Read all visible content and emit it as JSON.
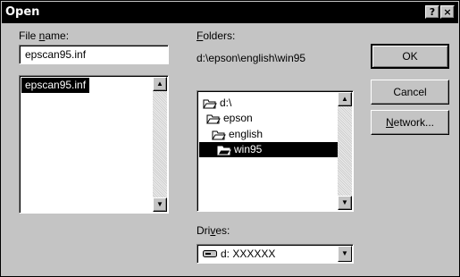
{
  "window": {
    "title": "Open",
    "help_glyph": "?",
    "close_glyph": "×"
  },
  "file_name": {
    "label_prefix": "File ",
    "label_mnemonic": "n",
    "label_suffix": "ame:",
    "value": "epscan95.inf",
    "list_items": [
      {
        "label": "epscan95.inf",
        "selected": true
      }
    ]
  },
  "folders": {
    "label_mnemonic": "F",
    "label_suffix": "olders:",
    "current_path": "d:\\epson\\english\\win95",
    "tree": [
      {
        "label": "d:\\",
        "icon": "open-folder-icon",
        "selected": false
      },
      {
        "label": "epson",
        "icon": "open-folder-icon",
        "selected": false
      },
      {
        "label": "english",
        "icon": "open-folder-icon",
        "selected": false
      },
      {
        "label": "win95",
        "icon": "open-folder-icon",
        "selected": true
      }
    ]
  },
  "drives": {
    "label_prefix": "Dri",
    "label_mnemonic": "v",
    "label_suffix": "es:",
    "value": "d: XXXXXX",
    "icon": "drive-icon"
  },
  "buttons": {
    "ok": "OK",
    "cancel": "Cancel",
    "network_mnemonic": "N",
    "network_suffix": "etwork..."
  },
  "icons": {
    "scroll_up": "▲",
    "scroll_down": "▼",
    "dropdown": "▼"
  },
  "colors": {
    "face": "#c4c4c4",
    "selection": "#000000",
    "titlebar": "#000000"
  }
}
